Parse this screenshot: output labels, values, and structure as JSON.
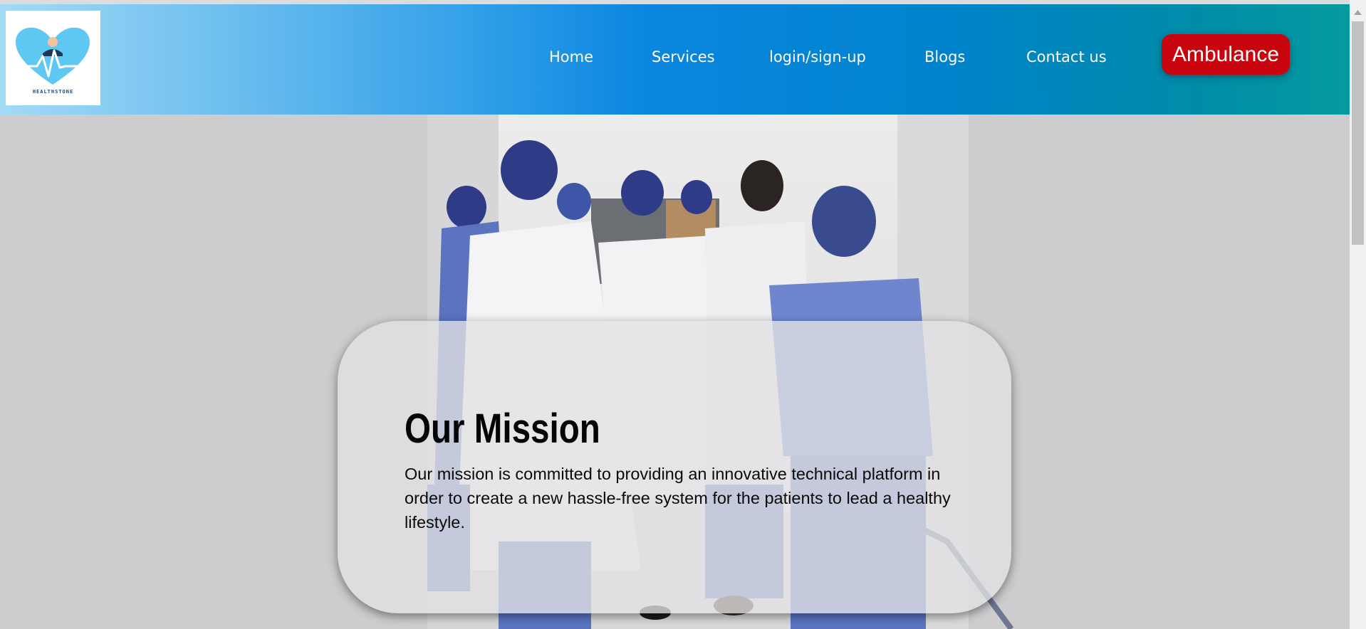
{
  "logo": {
    "caption": "HEALTHSTONE"
  },
  "nav": {
    "items": [
      {
        "label": "Home"
      },
      {
        "label": "Services"
      },
      {
        "label": "login/sign-up"
      },
      {
        "label": "Blogs"
      },
      {
        "label": "Contact us"
      }
    ],
    "ambulance_label": "Ambulance"
  },
  "mission": {
    "title": "Our Mission",
    "text": "Our mission is committed to providing an innovative technical platform in order to create a new hassle-free system for the patients to lead a healthy lifestyle."
  },
  "colors": {
    "ambulance": "#c8050e",
    "navbar_start": "#a3daf6",
    "navbar_end": "#049ba0",
    "scrub_blue": "#5a74c0",
    "cap_navy": "#2e3c88"
  }
}
